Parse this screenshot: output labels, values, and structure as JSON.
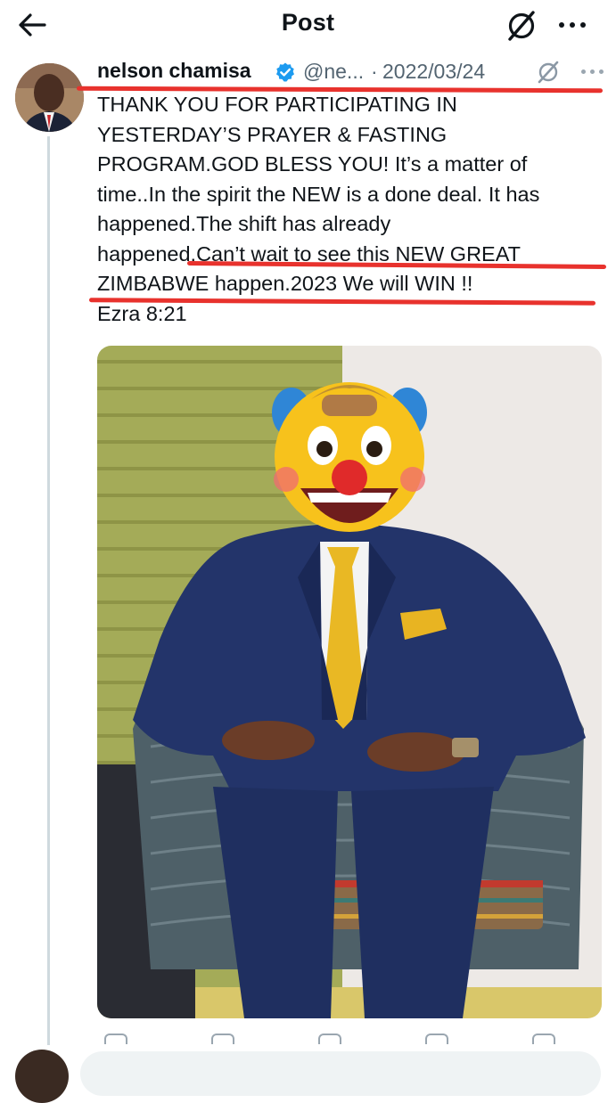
{
  "topbar": {
    "title": "Post"
  },
  "post": {
    "author_name": "nelson chamisa",
    "handle": "@ne...",
    "separator": "·",
    "date": "2022/03/24",
    "text": "THANK YOU FOR PARTICIPATING IN\nYESTERDAY’S PRAYER & FASTING\nPROGRAM.GOD BLESS YOU! It’s a matter of\ntime..In the spirit the NEW is a done deal. It has\nhappened.The shift has already\nhappened.Can’t wait to see this NEW GREAT\nZIMBABWE happen.2023 We will WIN !!\nEzra 8:21"
  },
  "icons": {
    "back": "arrow-left-icon",
    "grok": "grok-icon",
    "more": "more-horizontal-icon",
    "verified": "verified-badge-icon"
  },
  "colors": {
    "verified": "#1d9bf0",
    "annotation": "#e8322d",
    "secondary_text": "#536471"
  }
}
